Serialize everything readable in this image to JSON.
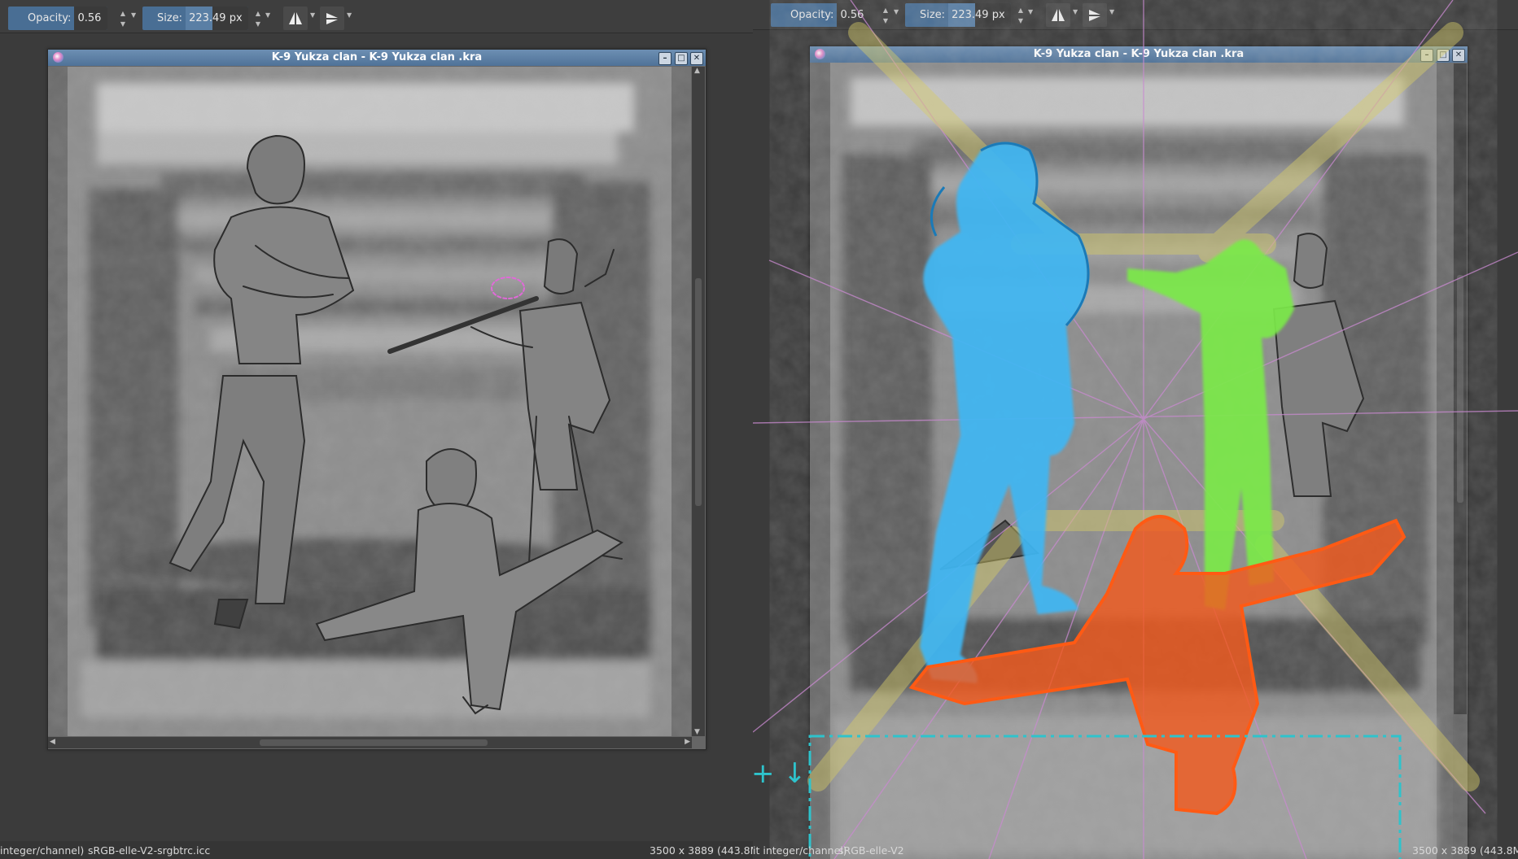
{
  "left": {
    "toolbar": {
      "opacity_label": "Opacity:",
      "opacity_value": "0.56",
      "size_label": "Size:",
      "size_value_pre": "223.",
      "size_value_post": "49 px"
    },
    "window": {
      "title": "K-9 Yukza clan  - K-9 Yukza clan .kra"
    },
    "status": {
      "color_depth": "integer/channel)",
      "profile": "sRGB-elle-V2-srgbtrc.icc",
      "dimensions": "3500 x 3889 (443.8M"
    }
  },
  "right": {
    "toolbar": {
      "opacity_label": "Opacity:",
      "opacity_value": "0.56",
      "size_label": "Size:",
      "size_value_pre": "223.",
      "size_value_post": "49 px"
    },
    "window": {
      "title": "K-9 Yukza clan  - K-9 Yukza clan .kra"
    },
    "status": {
      "color_depth": "it integer/channel)",
      "profile": "sRGB-elle-V2",
      "dimensions": "3500 x 3889 (443.8M"
    },
    "annotation": {
      "symbols": "+ ↓"
    }
  },
  "colors": {
    "accent_blue": "#496e94",
    "figure_blue": "#3fb6f2",
    "figure_green": "#7be84a",
    "figure_orange": "#f25a1e",
    "guide_yellow": "#d6cc68",
    "perspective_pink": "#c98ad0",
    "annotation_cyan": "#2ec3cc"
  },
  "icons": [
    "mirror-horizontal-icon",
    "mirror-vertical-icon",
    "window-minimize-icon",
    "window-maximize-icon",
    "window-close-icon",
    "krita-app-icon"
  ]
}
